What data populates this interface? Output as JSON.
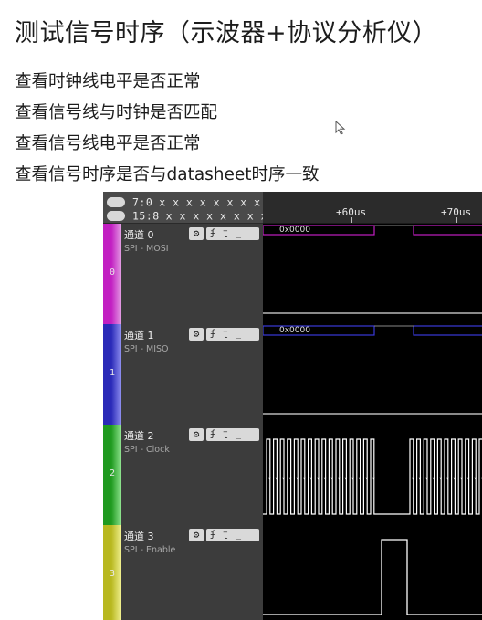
{
  "slide": {
    "title": "测试信号时序（示波器+协议分析仪）",
    "bullets": [
      "查看时钟线电平是否正常",
      "查看信号线与时钟是否匹配",
      "查看信号线电平是否正常",
      "查看信号时序是否与datasheet时序一致"
    ]
  },
  "analyzer": {
    "bus_rows": [
      {
        "label": "7:0",
        "value": "x x x x x x x x"
      },
      {
        "label": "15:8",
        "value": "x x x x x x x x"
      }
    ],
    "time_ticks": [
      "+60us",
      "+70us"
    ],
    "channels": [
      {
        "name": "通道 0",
        "sub": "SPI - MOSI",
        "num": "0",
        "color": "#c21fc2",
        "color_light": "#e39be3"
      },
      {
        "name": "通道 1",
        "sub": "SPI - MISO",
        "num": "1",
        "color": "#2a2ab8",
        "color_light": "#8f8ff0"
      },
      {
        "name": "通道 2",
        "sub": "SPI - Clock",
        "num": "2",
        "color": "#1f9a1f",
        "color_light": "#8fe38f"
      },
      {
        "name": "通道 3",
        "sub": "SPI - Enable",
        "num": "3",
        "color": "#b8b81f",
        "color_light": "#f0f08f"
      }
    ],
    "channel_controls": {
      "gear_icon": "⚙",
      "rising_edge": "ʄ",
      "falling_edge": "ʈ",
      "none": "_"
    },
    "protocol_values": {
      "mosi": "0x0000",
      "miso": "0x0000"
    }
  }
}
